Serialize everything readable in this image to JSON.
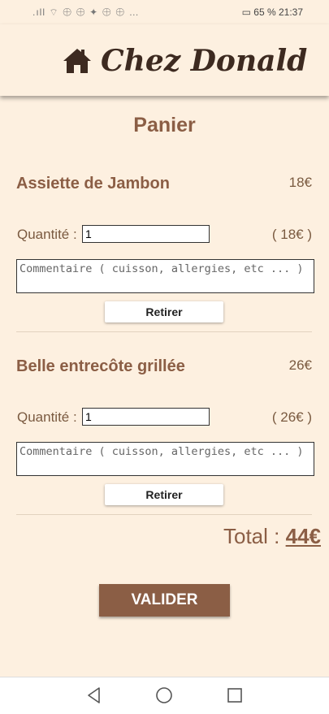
{
  "status_bar": {
    "left": ".ıll ⌔ ⊕ ⊕ ✦ ⊕ ⊕ …",
    "battery": "65 %",
    "time": "21:37"
  },
  "header": {
    "brand_name": "Chez Donald",
    "icon": "home-icon"
  },
  "page_title": "Panier",
  "items": [
    {
      "name": "Assiette de Jambon",
      "price": "18€",
      "quantity_label": "Quantité :",
      "quantity_value": "1",
      "line_total": "( 18€ )",
      "comment_placeholder": "Commentaire ( cuisson, allergies, etc ... )",
      "remove_label": "Retirer"
    },
    {
      "name": "Belle entrecôte grillée",
      "price": "26€",
      "quantity_label": "Quantité :",
      "quantity_value": "1",
      "line_total": "( 26€ )",
      "comment_placeholder": "Commentaire ( cuisson, allergies, etc ... )",
      "remove_label": "Retirer"
    }
  ],
  "total": {
    "label": "Total :",
    "value": "44€"
  },
  "validate_label": "VALIDER",
  "nav": {
    "back": "back-icon",
    "home": "home-circle-icon",
    "recents": "recents-icon"
  },
  "colors": {
    "background": "#fdf0e0",
    "accent": "#8b5e45",
    "brand_text": "#3d2a20"
  }
}
